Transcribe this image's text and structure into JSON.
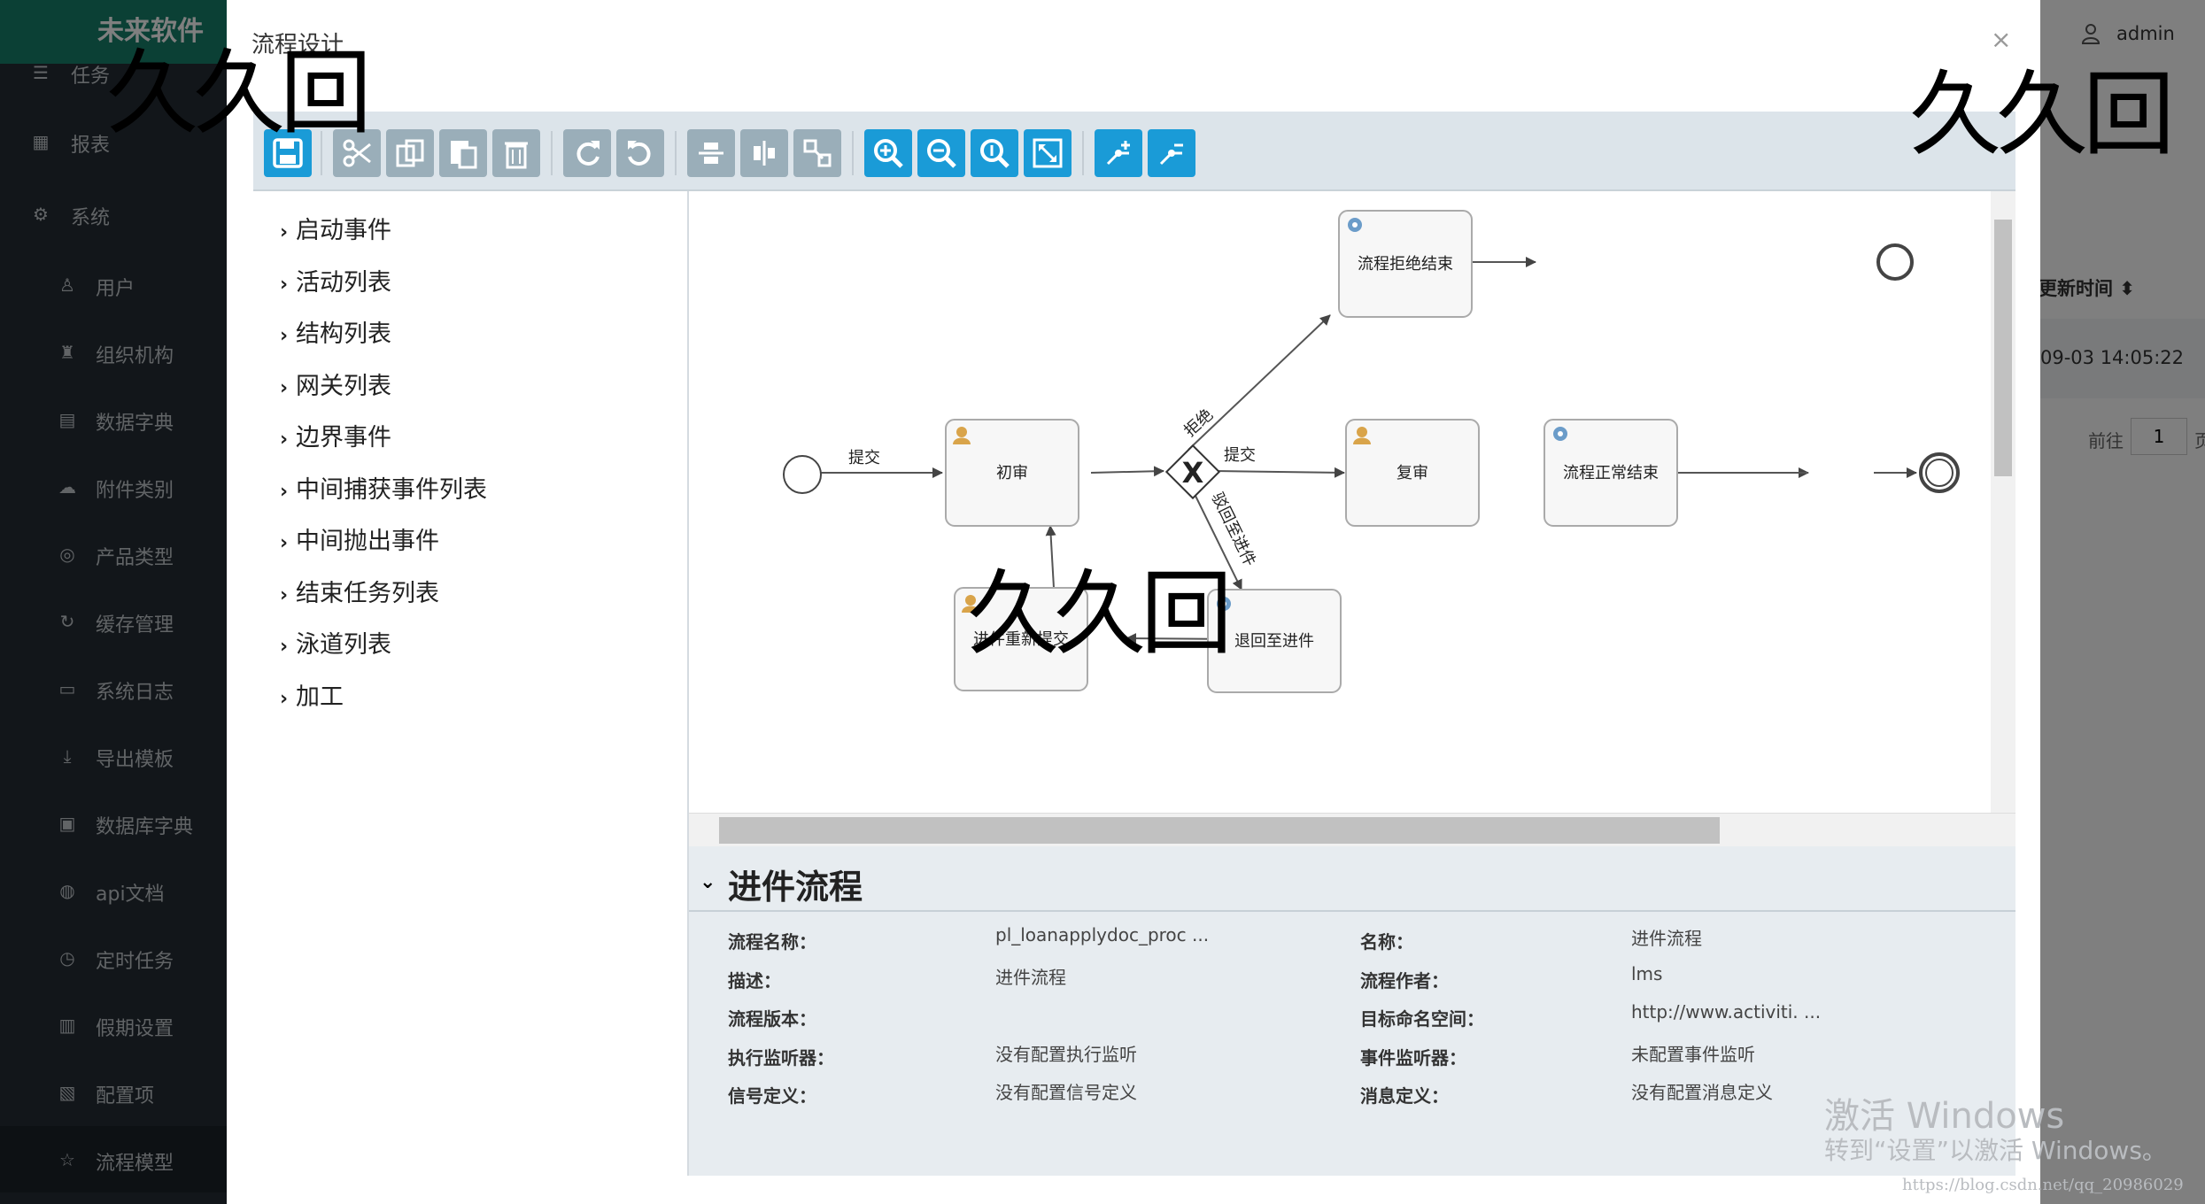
{
  "brand": "未来软件",
  "sidebar": {
    "items": [
      {
        "label": "任务",
        "icon": "tasks-icon",
        "level": "top"
      },
      {
        "label": "报表",
        "icon": "report-icon",
        "level": "top"
      },
      {
        "label": "系统",
        "icon": "gear-icon",
        "level": "top"
      },
      {
        "label": "用户",
        "icon": "user-icon",
        "level": "sub"
      },
      {
        "label": "组织机构",
        "icon": "org-icon",
        "level": "sub"
      },
      {
        "label": "数据字典",
        "icon": "dictionary-icon",
        "level": "sub"
      },
      {
        "label": "附件类别",
        "icon": "cloud-icon",
        "level": "sub"
      },
      {
        "label": "产品类型",
        "icon": "target-icon",
        "level": "sub"
      },
      {
        "label": "缓存管理",
        "icon": "refresh-icon",
        "level": "sub"
      },
      {
        "label": "系统日志",
        "icon": "file-icon",
        "level": "sub"
      },
      {
        "label": "导出模板",
        "icon": "download-icon",
        "level": "sub"
      },
      {
        "label": "数据库字典",
        "icon": "database-icon",
        "level": "sub"
      },
      {
        "label": "api文档",
        "icon": "globe-icon",
        "level": "sub"
      },
      {
        "label": "定时任务",
        "icon": "clock-icon",
        "level": "sub"
      },
      {
        "label": "假期设置",
        "icon": "calendar-icon",
        "level": "sub"
      },
      {
        "label": "配置项",
        "icon": "config-icon",
        "level": "sub"
      },
      {
        "label": "流程模型",
        "icon": "star-icon",
        "level": "sub",
        "active": true
      }
    ]
  },
  "background": {
    "admin": "admin",
    "column": "更新时间 ⬍",
    "time": "09-03 14:05:22",
    "goto": "前往",
    "page": "1",
    "page_unit": "页"
  },
  "modal": {
    "title": "流程设计",
    "close": "×"
  },
  "toolbar": {
    "buttons": [
      "save-icon",
      "cut-icon",
      "copy-icon",
      "paste-icon",
      "delete-icon",
      "redo-icon",
      "undo-icon",
      "align-vertical-icon",
      "align-horizontal-icon",
      "same-size-icon",
      "zoom-in-icon",
      "zoom-out-icon",
      "zoom-actual-icon",
      "zoom-fit-icon",
      "bend-add-icon",
      "bend-remove-icon"
    ]
  },
  "palette": {
    "items": [
      "启动事件",
      "活动列表",
      "结构列表",
      "网关列表",
      "边界事件",
      "中间捕获事件列表",
      "中间抛出事件",
      "结束任务列表",
      "泳道列表",
      "加工"
    ]
  },
  "diagram": {
    "nodes": {
      "first_review": "初审",
      "reject_end_task": "流程拒绝结束",
      "second_review": "复审",
      "normal_end_task": "流程正常结束",
      "resubmit": "进件重新提交",
      "back_to_entry": "退回至进件"
    },
    "gateway": "X",
    "edges": {
      "submit1": "提交",
      "reject": "拒绝",
      "submit2": "提交",
      "return": "驳回至进件"
    }
  },
  "properties": {
    "title": "进件流程",
    "rows": [
      {
        "label1": "流程名称：",
        "value1": "pl_loanapplydoc_proc ...",
        "label2": "名称：",
        "value2": "进件流程"
      },
      {
        "label1": "描述：",
        "value1": "进件流程",
        "label2": "流程作者：",
        "value2": "lms"
      },
      {
        "label1": "流程版本：",
        "value1": "",
        "label2": "目标命名空间：",
        "value2": "http://www.activiti. ..."
      },
      {
        "label1": "执行监听器：",
        "value1": "没有配置执行监听",
        "label2": "事件监听器：",
        "value2": "未配置事件监听"
      },
      {
        "label1": "信号定义：",
        "value1": "没有配置信号定义",
        "label2": "消息定义：",
        "value2": "没有配置消息定义"
      }
    ]
  },
  "watermarks": {
    "text": "久久回",
    "activate_line1": "激活 Windows",
    "activate_line2": "转到“设置”以激活 Windows。",
    "blog": "https://blog.csdn.net/qq_20986029"
  }
}
